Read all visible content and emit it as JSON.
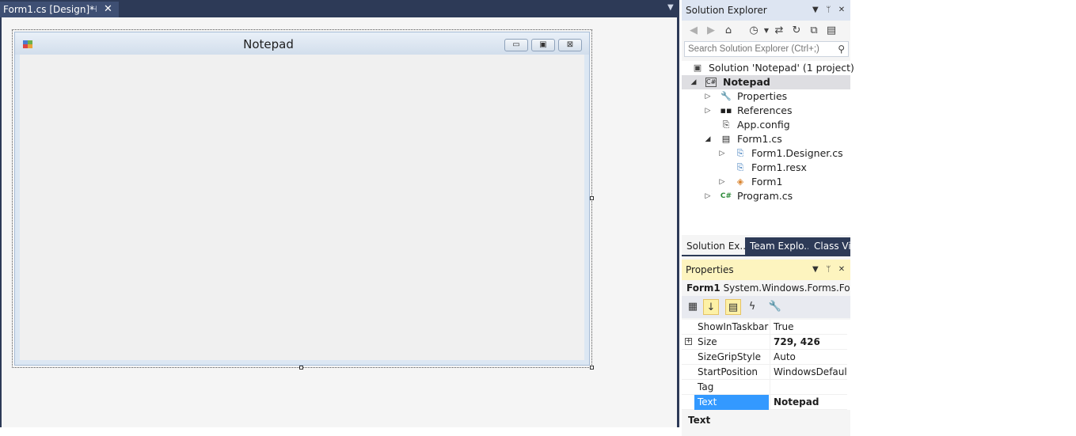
{
  "document_tab": {
    "title": "Form1.cs [Design]*",
    "pin": "⊣",
    "close": "✕"
  },
  "form": {
    "title": "Notepad"
  },
  "solution_explorer": {
    "header": "Solution Explorer",
    "search_placeholder": "Search Solution Explorer (Ctrl+;)",
    "tree": [
      {
        "label": "Solution 'Notepad' (1 project)",
        "icon": "solution-icon"
      },
      {
        "label": "Notepad",
        "icon": "csharp-project-icon",
        "expanded": true,
        "selected": true
      },
      {
        "label": "Properties",
        "icon": "wrench-icon"
      },
      {
        "label": "References",
        "icon": "references-icon"
      },
      {
        "label": "App.config",
        "icon": "config-file-icon"
      },
      {
        "label": "Form1.cs",
        "icon": "form-file-icon",
        "expanded": true
      },
      {
        "label": "Form1.Designer.cs",
        "icon": "cs-file-icon"
      },
      {
        "label": "Form1.resx",
        "icon": "resx-file-icon"
      },
      {
        "label": "Form1",
        "icon": "class-icon"
      },
      {
        "label": "Program.cs",
        "icon": "csharp-file-icon"
      }
    ],
    "bottom_tabs": [
      "Solution Ex...",
      "Team Explo...",
      "Class Vie"
    ]
  },
  "properties": {
    "header": "Properties",
    "object_name": "Form1",
    "object_type": "System.Windows.Forms.Form",
    "rows": [
      {
        "name": "ShowInTaskbar",
        "value": "True"
      },
      {
        "name": "Size",
        "value": "729, 426"
      },
      {
        "name": "SizeGripStyle",
        "value": "Auto"
      },
      {
        "name": "StartPosition",
        "value": "WindowsDefaultL"
      },
      {
        "name": "Tag",
        "value": ""
      },
      {
        "name": "Text",
        "value": "Notepad"
      }
    ],
    "description_title": "Text"
  },
  "colors": {
    "chrome": "#2d3a57",
    "selection": "#3399ff",
    "properties_header": "#fdf4bf"
  }
}
